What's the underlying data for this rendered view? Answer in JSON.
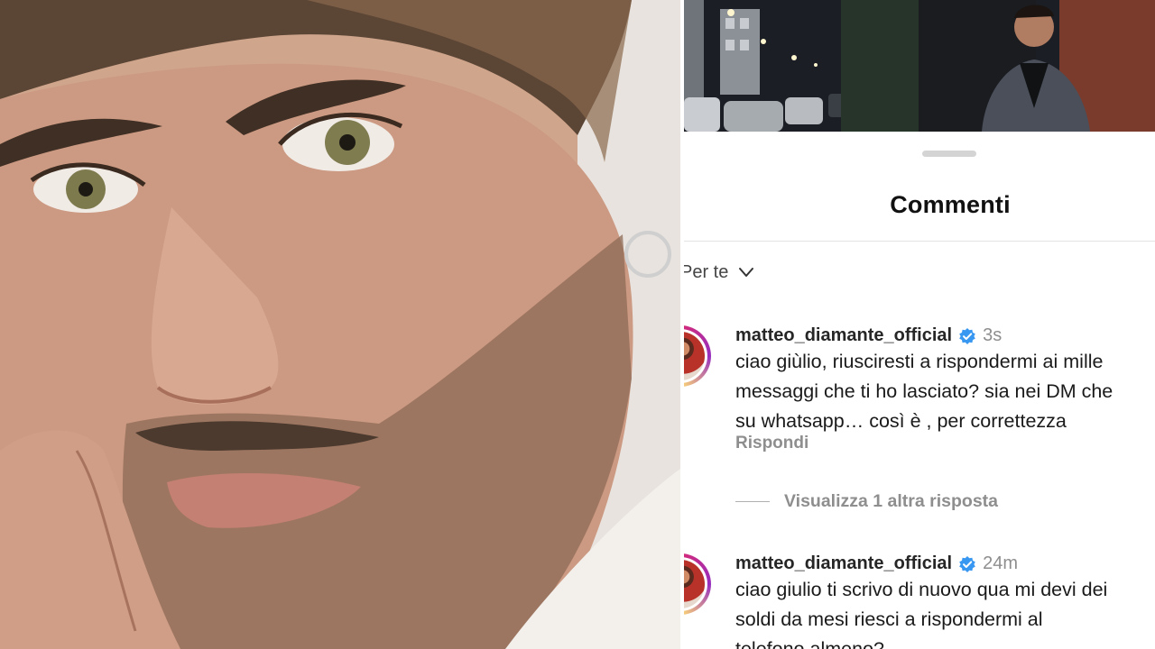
{
  "sheet": {
    "title": "Commenti",
    "sort_label": "Per te",
    "sort_icon": "chevron-down-icon"
  },
  "comments": [
    {
      "username": "matteo_diamante_official",
      "verified": true,
      "time": "3s",
      "text": "ciao giùlio, riusciresti a rispondermi ai mille\nmessaggi che ti ho lasciato? sia nei DM che\nsu whatsapp… così è , per correttezza",
      "reply_label": "Rispondi"
    },
    {
      "username": "matteo_diamante_official",
      "verified": true,
      "time": "24m",
      "text": "ciao giulio ti scrivo di nuovo qua mi devi dei\nsoldi da mesi riesci a rispondermi al\ntelefono almeno?"
    }
  ],
  "view_more_replies": "Visualizza 1 altra risposta",
  "colors": {
    "verified_badge": "#3897f0",
    "story_ring": [
      "#d62976",
      "#962fbf",
      "#feda75",
      "#fa7e1e"
    ],
    "muted_text": "#8e8e8e"
  }
}
